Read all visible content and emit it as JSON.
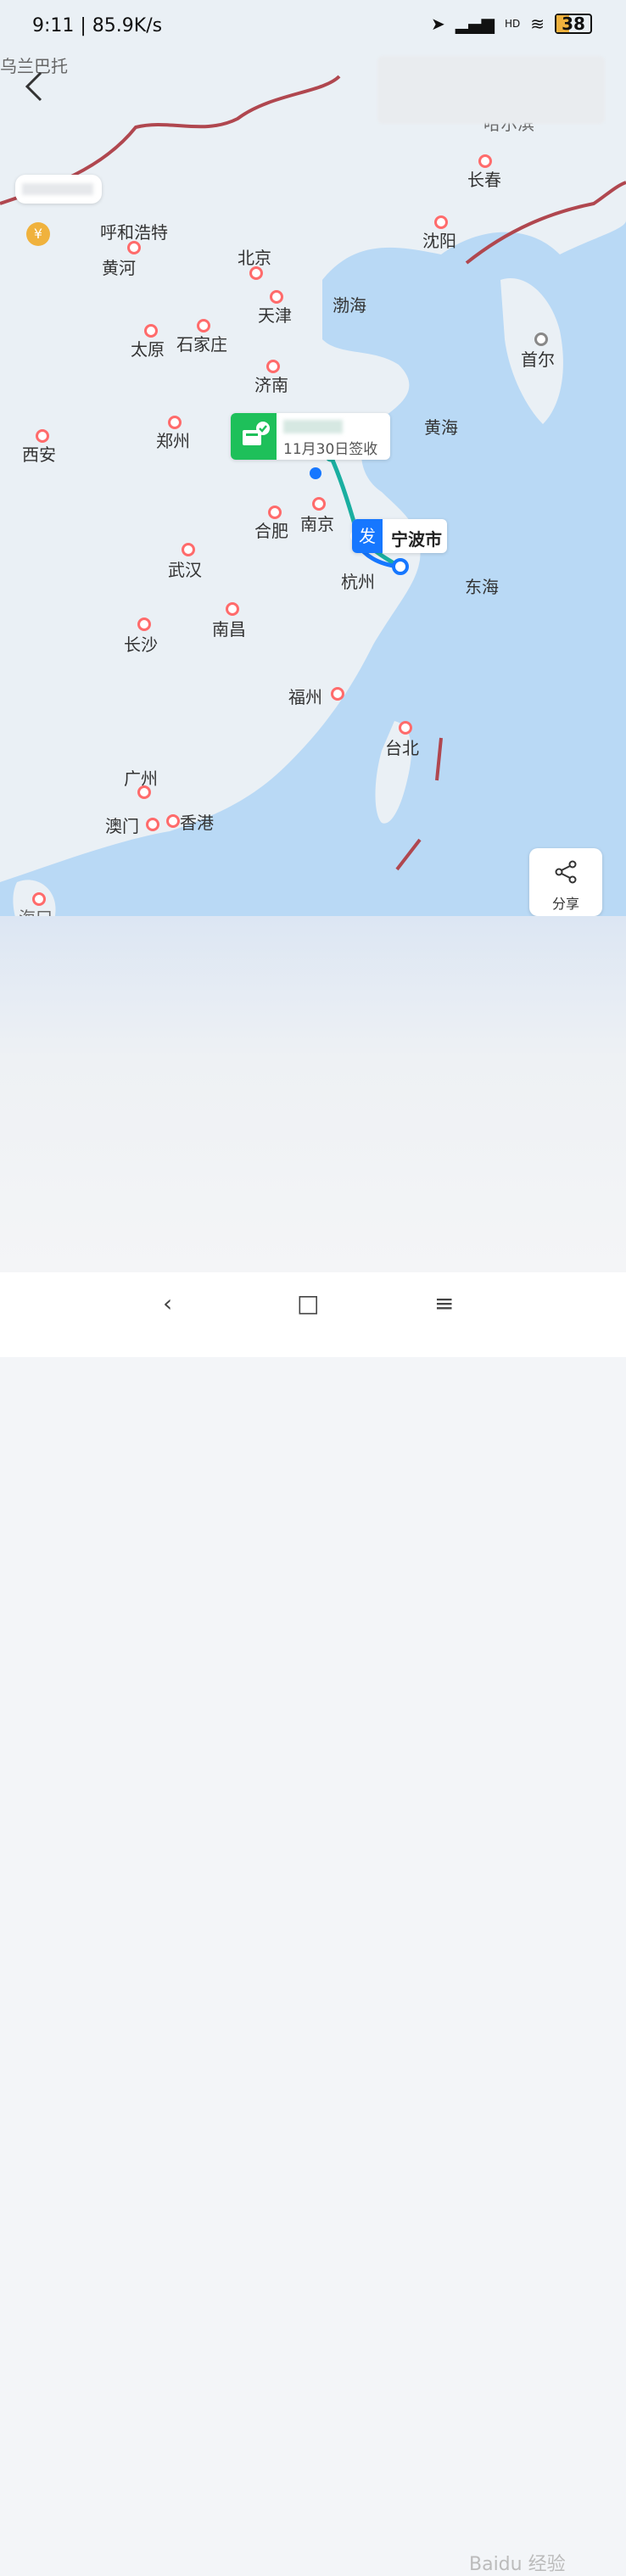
{
  "status_bar": {
    "time_speed": "9:11 | 85.9K/s",
    "battery": "38",
    "battery_level_percent": 38,
    "hd_label": "HD"
  },
  "map": {
    "cities": [
      {
        "name": "乌兰巴托"
      },
      {
        "name": "哈尔滨"
      },
      {
        "name": "长春"
      },
      {
        "name": "呼和浩特"
      },
      {
        "name": "黄河"
      },
      {
        "name": "沈阳"
      },
      {
        "name": "北京"
      },
      {
        "name": "渤海"
      },
      {
        "name": "天津"
      },
      {
        "name": "首尔"
      },
      {
        "name": "太原"
      },
      {
        "name": "石家庄"
      },
      {
        "name": "济南"
      },
      {
        "name": "黄海"
      },
      {
        "name": "郑州"
      },
      {
        "name": "西安"
      },
      {
        "name": "南京"
      },
      {
        "name": "合肥"
      },
      {
        "name": "杭州"
      },
      {
        "name": "东海"
      },
      {
        "name": "武汉"
      },
      {
        "name": "南昌"
      },
      {
        "name": "长沙"
      },
      {
        "name": "福州"
      },
      {
        "name": "台北"
      },
      {
        "name": "广州"
      },
      {
        "name": "澳门"
      },
      {
        "name": "香港"
      },
      {
        "name": "海口"
      }
    ],
    "signed_label": "11月30日签收",
    "send_tag": "发",
    "send_city": "宁波市"
  },
  "share_button": {
    "label": "分享"
  },
  "watermark": "Baidu 经验",
  "colors": {
    "route": "#1aaea0",
    "send": "#1677ff",
    "sign": "#1ec05a",
    "city_dot": "#ff6b6b",
    "sea": "#b9d9f5",
    "land": "#eaf0f5"
  }
}
